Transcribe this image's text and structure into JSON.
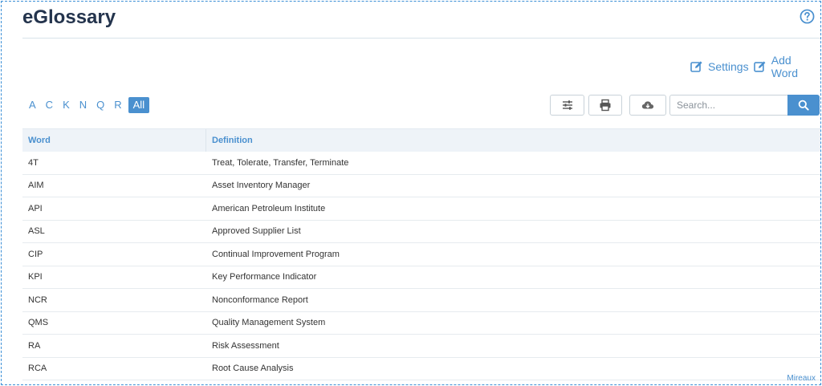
{
  "header": {
    "title": "eGlossary",
    "help_icon": "question-circle-icon"
  },
  "actions": {
    "settings_label": "Settings",
    "add_word_label": "Add Word"
  },
  "alphabet": {
    "letters": [
      "A",
      "C",
      "K",
      "N",
      "Q",
      "R"
    ],
    "all_label": "All"
  },
  "toolbar": {
    "filter_icon": "sliders-icon",
    "print_icon": "printer-icon",
    "download_icon": "cloud-download-icon",
    "search_placeholder": "Search...",
    "search_icon": "search-icon"
  },
  "table": {
    "columns": [
      "Word",
      "Definition"
    ],
    "rows": [
      [
        "4T",
        "Treat, Tolerate, Transfer, Terminate"
      ],
      [
        "AIM",
        "Asset Inventory Manager"
      ],
      [
        "API",
        "American Petroleum Institute"
      ],
      [
        "ASL",
        "Approved Supplier List"
      ],
      [
        "CIP",
        "Continual Improvement Program"
      ],
      [
        "KPI",
        "Key Performance Indicator"
      ],
      [
        "NCR",
        "Nonconformance Report"
      ],
      [
        "QMS",
        "Quality Management System"
      ],
      [
        "RA",
        "Risk Assessment"
      ],
      [
        "RCA",
        "Root Cause Analysis"
      ]
    ]
  },
  "footer": {
    "brand": "Mireaux"
  },
  "colors": {
    "accent": "#4a90cf",
    "title": "#24344d",
    "header_bg": "#eef3f8"
  }
}
